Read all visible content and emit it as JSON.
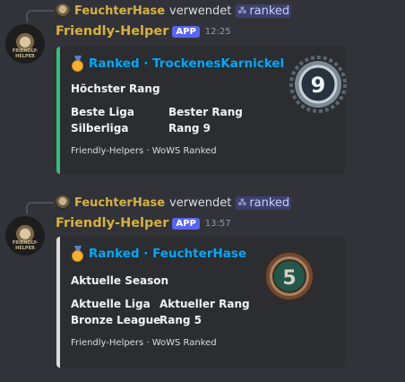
{
  "messages": [
    {
      "reply": {
        "user": "FeuchterHase",
        "verb": "verwendet",
        "command": "ranked",
        "command_icon": "command-grid-icon"
      },
      "bot": {
        "name": "Friendly-Helper",
        "badge": "APP",
        "time": "12:25",
        "avatar_text": "FRIENDLY-HELPER"
      },
      "embed": {
        "accent": "#2fc17a",
        "author": "Ranked · TrockenesKarnickel",
        "author_icon": "medal-icon",
        "title": "Höchster Rang",
        "fields": [
          {
            "name": "Beste Liga",
            "value": "Silberliga"
          },
          {
            "name": "Bester Rang",
            "value": "Rang 9"
          }
        ],
        "footer": "Friendly-Helpers · WoWS Ranked",
        "thumbnail": {
          "rank_number": "9",
          "style": "silver"
        }
      }
    },
    {
      "reply": {
        "user": "FeuchterHase",
        "verb": "verwendet",
        "command": "ranked",
        "command_icon": "command-grid-icon"
      },
      "bot": {
        "name": "Friendly-Helper",
        "badge": "APP",
        "time": "13:57",
        "avatar_text": "FRIENDLY-HELPER"
      },
      "embed": {
        "accent": "#dbdee1",
        "author": "Ranked · FeuchterHase",
        "author_icon": "medal-icon",
        "title": "Aktuelle Season",
        "fields": [
          {
            "name": "Aktuelle Liga",
            "value": "Bronze League"
          },
          {
            "name": "Aktueller Rang",
            "value": "Rang 5"
          }
        ],
        "footer": "Friendly-Helpers · WoWS Ranked",
        "thumbnail": {
          "rank_number": "5",
          "style": "bronze"
        }
      }
    }
  ]
}
